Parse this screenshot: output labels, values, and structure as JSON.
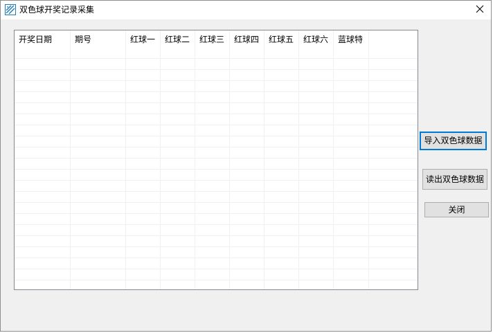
{
  "window": {
    "title": "双色球开奖记录采集"
  },
  "table": {
    "columns": [
      "开奖日期",
      "期号",
      "红球一",
      "红球二",
      "红球三",
      "红球四",
      "红球五",
      "红球六",
      "蓝球特"
    ],
    "rows": []
  },
  "buttons": {
    "import_label": "导入双色球数据",
    "export_label": "读出双色球数据",
    "close_label": "关闭"
  },
  "icons": {
    "app": "app-logo-icon",
    "close": "close-icon"
  },
  "colors": {
    "focus_border": "#0078d7",
    "grid_border": "#828790",
    "window_bg": "#f0f0f0"
  }
}
